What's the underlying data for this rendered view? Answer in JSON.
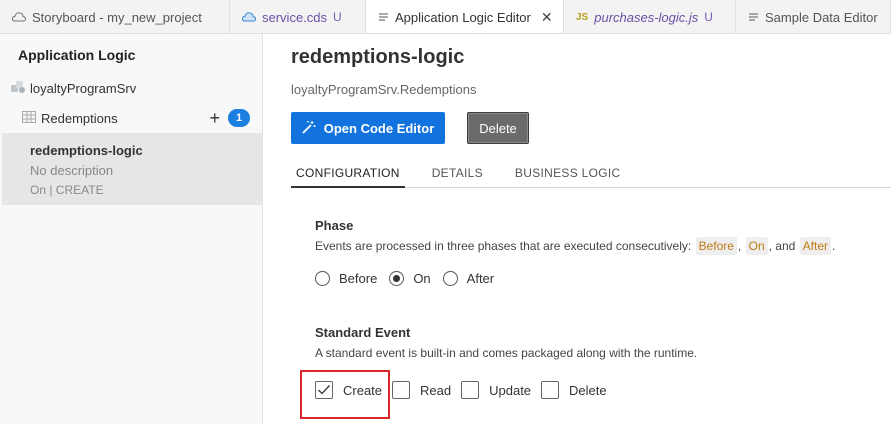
{
  "tabs": [
    {
      "label": "Storyboard - my_new_project",
      "icon": "storyboard-icon"
    },
    {
      "label": "service.cds",
      "modified": "U",
      "icon": "cds-icon"
    },
    {
      "label": "Application Logic Editor",
      "icon": "doc-icon",
      "close": "✕"
    },
    {
      "label": "purchases-logic.js",
      "modified": "U",
      "icon_text": "JS"
    },
    {
      "label": "Sample Data Editor",
      "icon": "doc-icon"
    }
  ],
  "sidebar": {
    "title": "Application Logic",
    "service": "loyaltyProgramSrv",
    "entity": "Redemptions",
    "badge": "1",
    "selected": {
      "name": "redemptions-logic",
      "description": "No description",
      "status": "On | CREATE"
    }
  },
  "main": {
    "title": "redemptions-logic",
    "subtitle": "loyaltyProgramSrv.Redemptions",
    "open_code_editor": "Open Code Editor",
    "delete": "Delete",
    "tabs": [
      "CONFIGURATION",
      "DETAILS",
      "BUSINESS LOGIC"
    ],
    "active_tab": "CONFIGURATION",
    "phase": {
      "heading": "Phase",
      "text_prefix": "Events are processed in three phases that are executed consecutively:",
      "chip1": "Before",
      "sep1": ",",
      "chip2": "On",
      "sep2": ", and",
      "chip3": "After",
      "end": ".",
      "options": [
        "Before",
        "On",
        "After"
      ],
      "selected": "On"
    },
    "standard_event": {
      "heading": "Standard Event",
      "text": "A standard event is built-in and comes packaged along with the runtime.",
      "options": [
        "Create",
        "Read",
        "Update",
        "Delete"
      ],
      "checked": [
        "Create"
      ]
    }
  }
}
